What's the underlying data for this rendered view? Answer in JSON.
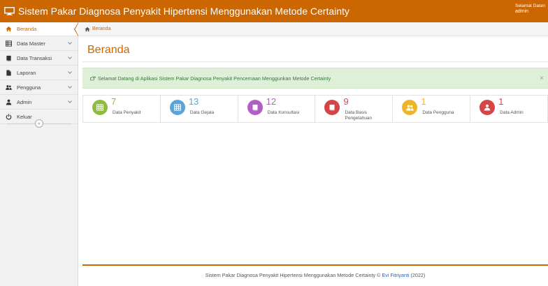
{
  "header": {
    "title": "Sistem Pakar Diagnosa Penyakit Hipertensi Menggunakan Metode Certainty",
    "greeting": "Selamat Datan",
    "username": "admin"
  },
  "sidebar": {
    "items": [
      {
        "label": "Beranda",
        "icon": "home-icon"
      },
      {
        "label": "Data Master",
        "icon": "table-icon"
      },
      {
        "label": "Data Transaksi",
        "icon": "book-icon"
      },
      {
        "label": "Laporan",
        "icon": "file-icon"
      },
      {
        "label": "Pengguna",
        "icon": "users-icon"
      },
      {
        "label": "Admin",
        "icon": "user-icon"
      },
      {
        "label": "Keluar",
        "icon": "power-icon"
      }
    ],
    "collapse_glyph": "«"
  },
  "breadcrumb": {
    "label": "Beranda"
  },
  "page": {
    "title": "Beranda"
  },
  "alert": {
    "message": "Selamat Datang di Aplikasi Sistem Pakar Diagnosa Penyakit Pencernaan Menggunkan Metode Certainty",
    "close_glyph": "×"
  },
  "stats": [
    {
      "value": "7",
      "label": "Data Penyakit",
      "color": "#8fbc3f",
      "icon": "table-icon"
    },
    {
      "value": "13",
      "label": "Data Gejala",
      "color": "#5ba4d8",
      "icon": "table-icon"
    },
    {
      "value": "12",
      "label": "Data Konsultasi",
      "color": "#b15fc6",
      "icon": "book-icon"
    },
    {
      "value": "9",
      "label": "Data Basis Pengetahuan",
      "color": "#d64545",
      "icon": "book-icon"
    },
    {
      "value": "1",
      "label": "Data Pengguna",
      "color": "#f0b429",
      "icon": "users-icon"
    },
    {
      "value": "1",
      "label": "Data Admin",
      "color": "#d64545",
      "icon": "user-icon"
    }
  ],
  "footer": {
    "text": "Sistem Pakar Diagnosa Penyakit Hipertensi Menggunakan Metode Certainty © ",
    "author": "Evi Fitriyanti",
    "year": " (2022)"
  },
  "colors": {
    "brand": "#cc6600",
    "alert_bg": "#dff0d8",
    "alert_text": "#3c763d"
  }
}
